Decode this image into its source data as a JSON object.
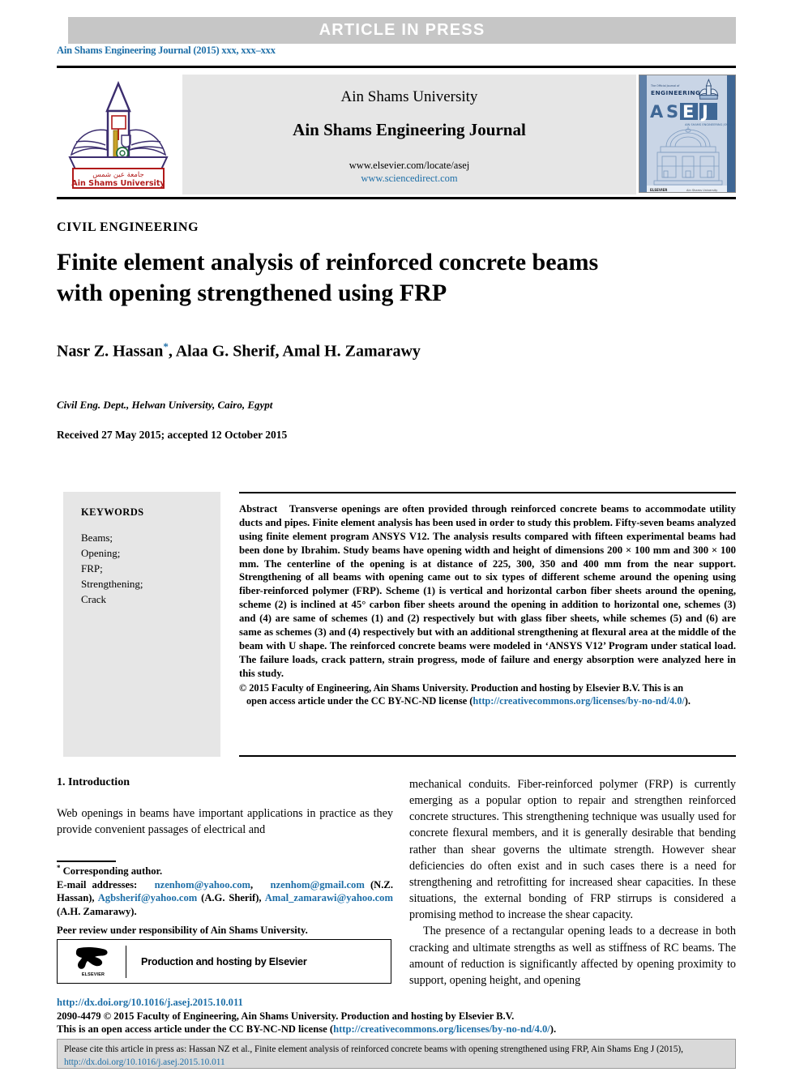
{
  "banner": {
    "press_label": "ARTICLE  IN  PRESS",
    "journal_ref": "Ain Shams Engineering Journal (2015) xxx, xxx–xxx"
  },
  "masthead": {
    "university": "Ain Shams University",
    "journal_title": "Ain Shams Engineering Journal",
    "url_elsevier": "www.elsevier.com/locate/asej",
    "url_sciencedirect": "www.sciencedirect.com",
    "logo_caption_ar": "جامعة عين شمس",
    "logo_caption_en": "Ain Shams University",
    "cover_line1": "The Official Journal of",
    "cover_line2": "ENGINEERING",
    "cover_acronym": "ASEJ",
    "cover_sub": "AIN SHAMS ENGINEERING JOURNAL",
    "cover_footer_left": "ELSEVIER",
    "cover_footer_right": "Ain Shams University"
  },
  "article": {
    "section_label": "CIVIL ENGINEERING",
    "title": "Finite element analysis of reinforced concrete beams with opening strengthened using FRP",
    "authors": "Nasr Z. Hassan",
    "authors_rest": ", Alaa G. Sherif, Amal H. Zamarawy",
    "corresponding_marker": "*",
    "affiliation": "Civil Eng. Dept., Helwan University, Cairo, Egypt",
    "dates": "Received 27 May 2015; accepted 12 October 2015"
  },
  "keywords": {
    "heading": "KEYWORDS",
    "items": [
      "Beams;",
      "Opening;",
      "FRP;",
      "Strengthening;",
      "Crack"
    ]
  },
  "abstract": {
    "label": "Abstract",
    "text": "Transverse openings are often provided through reinforced concrete beams to accommodate utility ducts and pipes. Finite element analysis has been used in order to study this problem. Fifty-seven beams analyzed using finite element program ANSYS V12. The analysis results compared with fifteen experimental beams had been done by Ibrahim. Study beams have opening width and height of dimensions 200 × 100 mm and 300 × 100 mm. The centerline of the opening is at distance of 225, 300, 350 and 400 mm from the near support. Strengthening of all beams with opening came out to six types of different scheme around the opening using fiber-reinforced polymer (FRP). Scheme (1) is vertical and horizontal carbon fiber sheets around the opening, scheme (2) is inclined at 45° carbon fiber sheets around the opening in addition to horizontal one, schemes (3) and (4) are same of schemes (1) and (2) respectively but with glass fiber sheets, while schemes (5) and (6) are same as schemes (3) and (4) respectively but with an additional strengthening at flexural area at the middle of the beam with U shape. The reinforced concrete beams were modeled in ‘ANSYS V12’ Program under statical load. The failure loads, crack pattern, strain progress, mode of failure and energy absorption were analyzed here in this study.",
    "copyright_part1": "© 2015 Faculty of Engineering, Ain Shams University. Production and hosting by Elsevier B.V.  This is an",
    "copyright_part2": "open access article under the CC BY-NC-ND license (",
    "copyright_link": "http://creativecommons.org/licenses/by-no-nd/4.0/",
    "copyright_part3": ")."
  },
  "introduction": {
    "heading": "1. Introduction",
    "left_para": "Web openings in beams have important applications in practice as they provide convenient passages of electrical and",
    "right_para_1": "mechanical conduits. Fiber-reinforced polymer (FRP) is currently emerging as a popular option to repair and strengthen reinforced concrete structures. This strengthening technique was usually used for concrete flexural members, and it is generally desirable that bending rather than shear governs the ultimate strength. However shear deficiencies do often exist and in such cases there is a need for strengthening and retrofitting for increased shear capacities. In these situations, the external bonding of FRP stirrups is considered a promising method to increase the shear capacity.",
    "right_para_2": "The presence of a rectangular opening leads to a decrease in both cracking and ultimate strengths as well as stiffness of RC beams. The amount of reduction is significantly affected by opening proximity to support, opening height, and opening"
  },
  "footnote": {
    "corresponding": "Corresponding author.",
    "email_label": "E-mail addresses:",
    "email1": "nzenhom@yahoo.com",
    "email1_sep": ",",
    "email2": "nzenhom@gmail.com",
    "email2_owner": "(N.Z. Hassan),",
    "email3": "Agbsherif@yahoo.com",
    "email3_owner": "(A.G. Sherif),",
    "email4": "Amal_zamarawi@yahoo.com",
    "email4_owner": "(A.H. Zamarawy).",
    "peer_review": "Peer review under responsibility of Ain Shams University."
  },
  "elsevier_box": {
    "label": "Production and hosting by Elsevier",
    "logo_word": "ELSEVIER"
  },
  "bottom": {
    "doi": "http://dx.doi.org/10.1016/j.asej.2015.10.011",
    "copyright_line": "2090-4479 © 2015 Faculty of Engineering, Ain Shams University. Production and hosting by Elsevier B.V.",
    "license_pre": "This is an open access article under the CC BY-NC-ND license (",
    "license_link": "http://creativecommons.org/licenses/by-no-nd/4.0/",
    "license_post": ")."
  },
  "cite_box": {
    "text_pre": "Please cite this article in press as: Hassan NZ et al., Finite element analysis of reinforced concrete beams with opening strengthened using FRP, Ain Shams Eng J (2015), ",
    "link": "http://dx.doi.org/10.1016/j.asej.2015.10.011"
  },
  "colors": {
    "link": "#1e6fa8",
    "banner_gray": "#c6c6c6",
    "masthead_gray": "#e6e6e6",
    "cite_gray": "#d9d9d9"
  }
}
